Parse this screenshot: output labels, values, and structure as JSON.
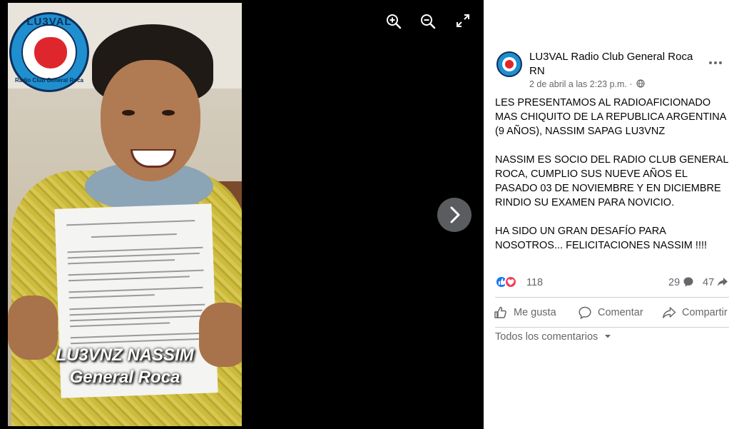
{
  "photo": {
    "logo_top_text": "LU3VAL",
    "logo_bottom_text": "Radio Club General Roca",
    "caption_line1": "LU3VNZ NASSIM",
    "caption_line2": "General Roca"
  },
  "viewer_toolbar": {
    "zoom_in_icon": "zoom-in-icon",
    "zoom_out_icon": "zoom-out-icon",
    "fullscreen_icon": "fullscreen-icon",
    "next_icon": "chevron-right-icon"
  },
  "post": {
    "page_name": "LU3VAL Radio Club General Roca RN",
    "date": "2 de abril a las 2:23 p.m. ·",
    "privacy_icon": "globe-icon",
    "paragraphs": [
      "LES PRESENTAMOS AL RADIOAFICIONADO MAS CHIQUITO DE LA REPUBLICA ARGENTINA (9 AÑOS), NASSIM SAPAG LU3VNZ",
      "NASSIM ES SOCIO DEL RADIO CLUB GENERAL ROCA, CUMPLIO SUS NUEVE AÑOS EL PASADO 03 DE NOVIEMBRE Y EN DICIEMBRE RINDIO SU EXAMEN PARA NOVICIO.",
      "HA SIDO UN GRAN DESAFÍO PARA NOSOTROS... FELICITACIONES NASSIM !!!!"
    ]
  },
  "stats": {
    "reactions": "118",
    "comments": "29",
    "shares": "47"
  },
  "actions": {
    "like": "Me gusta",
    "comment": "Comentar",
    "share": "Compartir"
  },
  "comments": {
    "filter_label": "Todos los comentarios"
  },
  "colors": {
    "facebook_blue": "#1877f2",
    "love_red": "#f33e58",
    "secondary_text": "#65676b"
  }
}
